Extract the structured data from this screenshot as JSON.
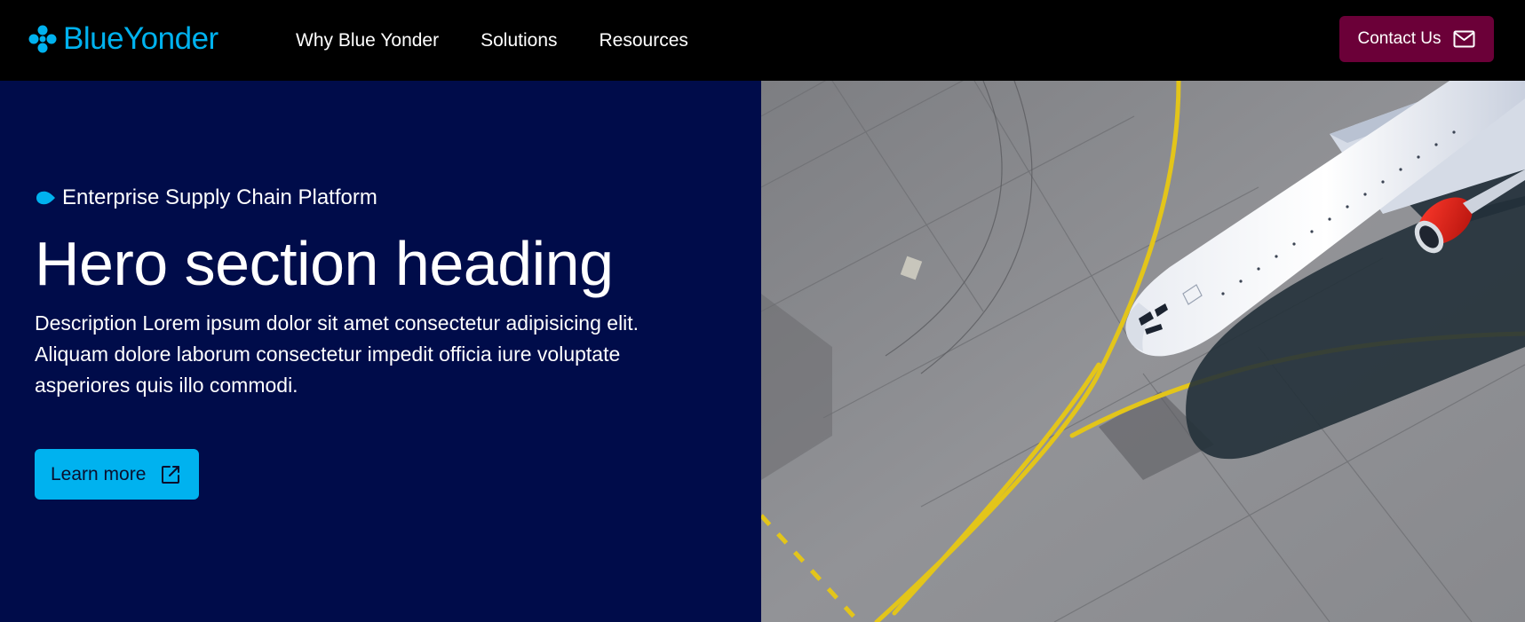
{
  "header": {
    "logo_text": "BlueYonder",
    "nav": [
      {
        "label": "Why Blue Yonder"
      },
      {
        "label": "Solutions"
      },
      {
        "label": "Resources"
      }
    ],
    "contact_label": "Contact Us",
    "contact_icon": "mail-icon"
  },
  "hero": {
    "eyebrow": "Enterprise Supply Chain Platform",
    "title": "Hero section heading",
    "description": "Description Lorem ipsum dolor sit amet consectetur adipisicing elit. Aliquam dolore laborum consectetur impedit officia iure voluptate asperiores quis illo commodi.",
    "cta_label": "Learn more",
    "cta_icon": "external-link-icon",
    "image_icon": "airplane-photo"
  },
  "colors": {
    "header_bg": "#000000",
    "brand_blue": "#00b2ef",
    "contact_bg": "#6b0038",
    "hero_bg": "#000c4a",
    "cta_bg": "#00b2ef"
  }
}
